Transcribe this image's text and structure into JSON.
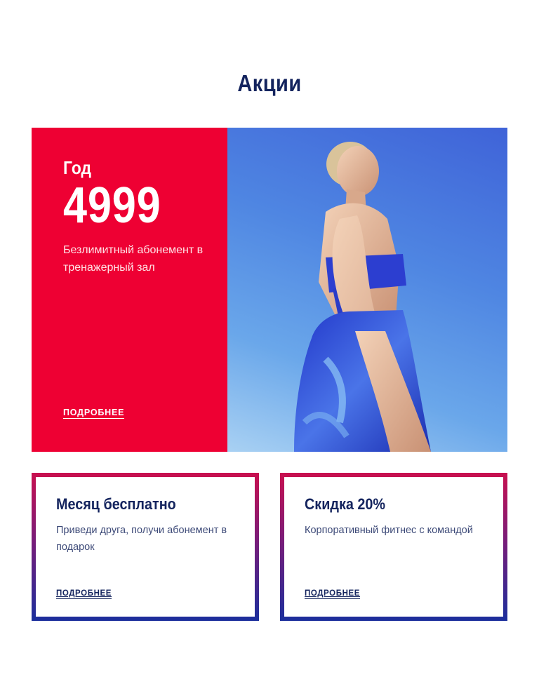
{
  "section": {
    "title": "Акции"
  },
  "hero": {
    "period": "Год",
    "price": "4999",
    "description": "Безлимитный абонемент в тренажерный зал",
    "link_label": "ПОДРОБНЕЕ",
    "accent_color": "#ee0033"
  },
  "cards": [
    {
      "title": "Месяц бесплатно",
      "description": "Приведи друга, получи абонемент в подарок",
      "link_label": "ПОДРОБНЕЕ"
    },
    {
      "title": "Скидка 20%",
      "description": "Корпоративный фитнес с командой",
      "link_label": "ПОДРОБНЕЕ"
    }
  ],
  "colors": {
    "heading": "#14245e",
    "gradient_top": "#c8104f",
    "gradient_bottom": "#1b2e9c"
  }
}
